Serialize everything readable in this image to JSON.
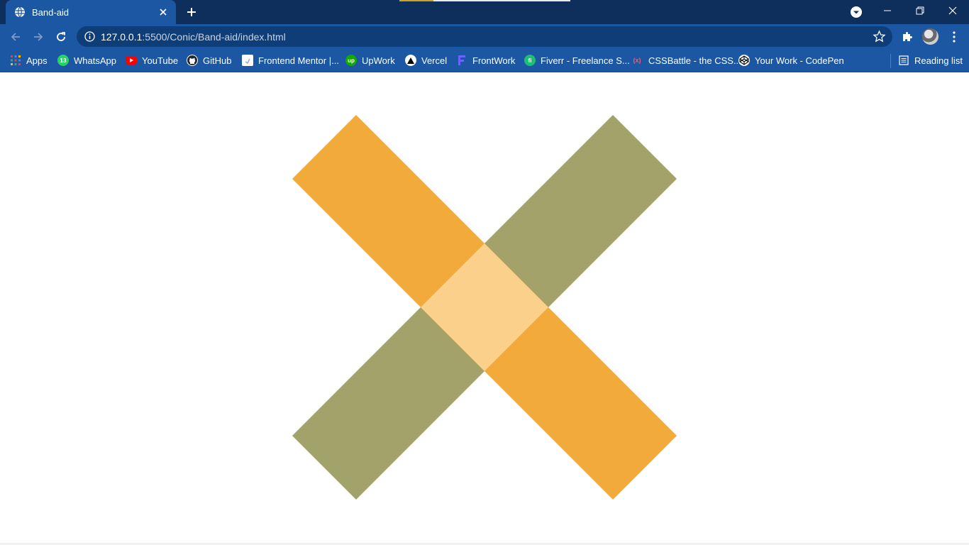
{
  "browser": {
    "tab": {
      "title": "Band-aid"
    },
    "omnibox": {
      "host": "127.0.0.1",
      "path": ":5500/Conic/Band-aid/index.html"
    },
    "download_progress": 0.2,
    "bookmarks": [
      {
        "label": "Apps",
        "icon": "apps-grid-icon",
        "color": "#f4b400"
      },
      {
        "label": "WhatsApp",
        "icon": "whatsapp-icon",
        "color": "#25d366",
        "badge": "13"
      },
      {
        "label": "YouTube",
        "icon": "youtube-icon",
        "color": "#ff0000"
      },
      {
        "label": "GitHub",
        "icon": "github-icon",
        "color": "#ffffff"
      },
      {
        "label": "Frontend Mentor |...",
        "icon": "frontend-mentor-icon",
        "color": "#ffffff"
      },
      {
        "label": "UpWork",
        "icon": "upwork-icon",
        "color": "#14a800",
        "badge": "up"
      },
      {
        "label": "Vercel",
        "icon": "vercel-icon",
        "color": "#000000"
      },
      {
        "label": "FrontWork",
        "icon": "frontwork-icon",
        "color": "#6c63ff"
      },
      {
        "label": "Fiverr - Freelance S...",
        "icon": "fiverr-icon",
        "color": "#1dbf73",
        "badge": "fi"
      },
      {
        "label": "CSSBattle - the CSS...",
        "icon": "cssbattle-icon",
        "color": "#ff5a5f",
        "badge": "(x)"
      },
      {
        "label": "Your Work - CodePen",
        "icon": "codepen-icon",
        "color": "#ffffff"
      }
    ],
    "reading_list": {
      "label": "Reading list",
      "icon": "reading-list-icon"
    },
    "colors": {
      "tabstrip": "#0e2f5b",
      "toolbar": "#1b57a3",
      "omnibox": "#0f3d78"
    }
  },
  "page": {
    "artwork": "band-aid",
    "colors": {
      "orange_strip": "#f2aa3a",
      "olive_strip": "#a3a26a",
      "center_pad": "#fbd08b",
      "background": "#ffffff"
    }
  }
}
